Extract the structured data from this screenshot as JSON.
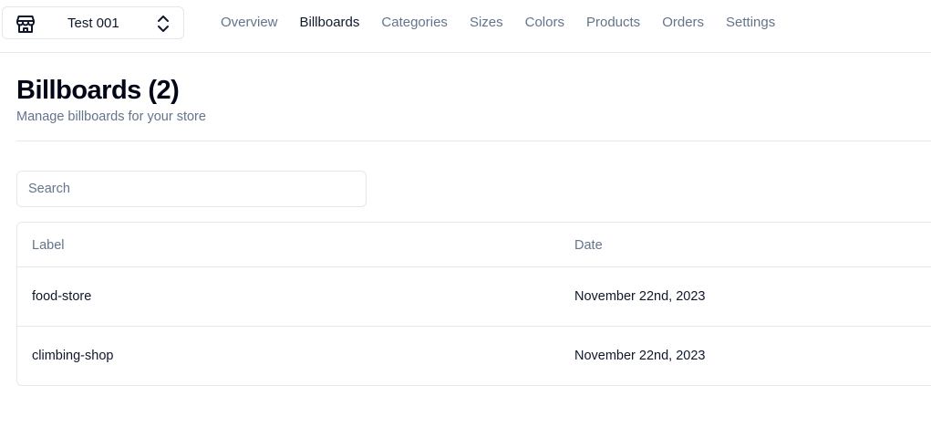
{
  "store_switcher": {
    "name": "Test 001"
  },
  "nav": [
    {
      "label": "Overview",
      "active": false
    },
    {
      "label": "Billboards",
      "active": true
    },
    {
      "label": "Categories",
      "active": false
    },
    {
      "label": "Sizes",
      "active": false
    },
    {
      "label": "Colors",
      "active": false
    },
    {
      "label": "Products",
      "active": false
    },
    {
      "label": "Orders",
      "active": false
    },
    {
      "label": "Settings",
      "active": false
    }
  ],
  "page": {
    "title": "Billboards (2)",
    "subtitle": "Manage billboards for your store"
  },
  "search": {
    "placeholder": "Search",
    "value": ""
  },
  "table": {
    "columns": [
      "Label",
      "Date"
    ],
    "rows": [
      {
        "label": "food-store",
        "date": "November 22nd, 2023"
      },
      {
        "label": "climbing-shop",
        "date": "November 22nd, 2023"
      }
    ]
  }
}
